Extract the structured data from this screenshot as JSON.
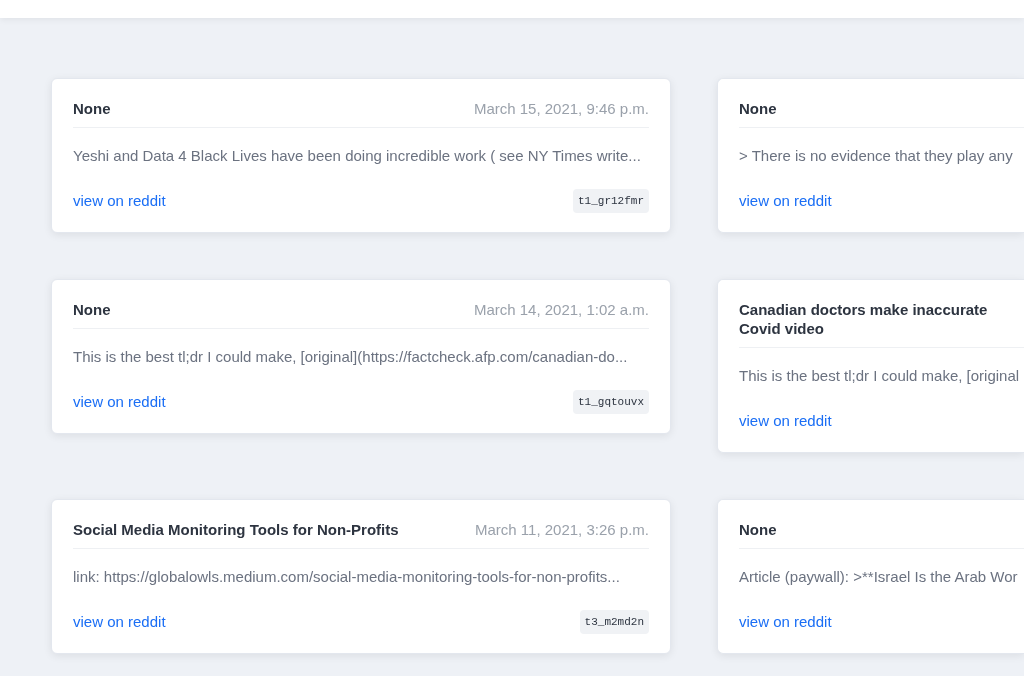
{
  "cards": [
    {
      "title": "None",
      "date": "March 15, 2021, 9:46 p.m.",
      "body": "Yeshi and Data 4 Black Lives have been doing incredible work ( see NY Times write...",
      "link": "view on reddit",
      "tag": "t1_gr12fmr"
    },
    {
      "title": "None",
      "body": "> There is no evidence that they play any",
      "link": "view on reddit"
    },
    {
      "title": "None",
      "date": "March 14, 2021, 1:02 a.m.",
      "body": "This is the best tl;dr I could make, [original](https://factcheck.afp.com/canadian-do...",
      "link": "view on reddit",
      "tag": "t1_gqtouvx"
    },
    {
      "title": "Canadian doctors make inaccurate Covid video",
      "body": "This is the best tl;dr I could make, [original",
      "link": "view on reddit"
    },
    {
      "title": "Social Media Monitoring Tools for Non-Profits",
      "date": "March 11, 2021, 3:26 p.m.",
      "body": "link: https://globalowls.medium.com/social-media-monitoring-tools-for-non-profits...",
      "link": "view on reddit",
      "tag": "t3_m2md2n"
    },
    {
      "title": "None",
      "body": "Article (paywall): >**Israel Is the Arab Wor",
      "link": "view on reddit"
    }
  ]
}
